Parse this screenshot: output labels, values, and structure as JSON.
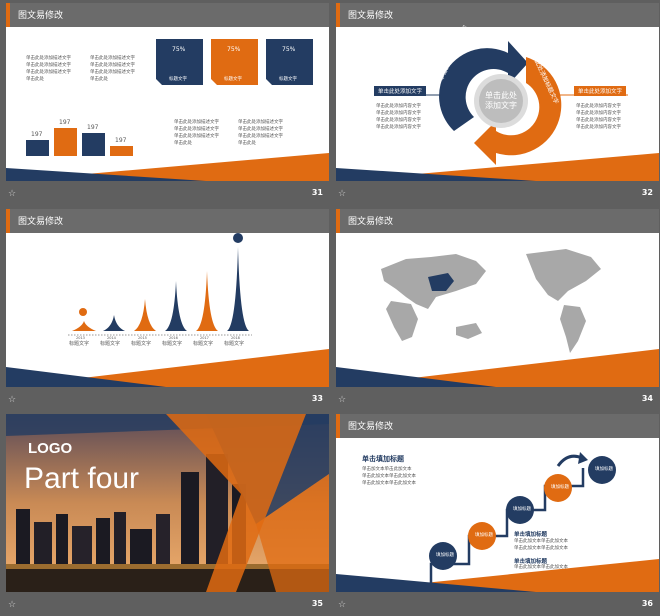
{
  "colors": {
    "navy": "#233c62",
    "orange": "#e06b12",
    "gray": "#6b6b6b"
  },
  "slides": [
    {
      "num": "31",
      "title": "图文易修改",
      "text_lines": [
        "单击此处添加描述文字",
        "单击此处添加描述文字",
        "单击此处添加描述文字",
        "单击此处"
      ],
      "bar_values": [
        "197",
        "197",
        "197",
        "197"
      ],
      "percents": [
        "75%",
        "75%",
        "75%"
      ],
      "box_labels": [
        "标题文字",
        "标题文字",
        "标题文字"
      ],
      "lines_b": [
        "单击此处添加描述文字",
        "单击此处添加描述文字",
        "单击此处添加描述文字",
        "单击此处"
      ]
    },
    {
      "num": "32",
      "title": "图文易修改",
      "center": "单击此处添加文字",
      "left_title": "单击此处添加文字",
      "right_title": "单击此处添加文字",
      "arc_left": "单击此处添加标题文字",
      "arc_right": "单击此处添加标题文字",
      "items": [
        "单击此处添加内容文字",
        "单击此处添加内容文字",
        "单击此处添加内容文字",
        "单击此处添加内容文字"
      ]
    },
    {
      "num": "33",
      "title": "图文易修改",
      "labels": [
        "标题文字",
        "标题文字",
        "标题文字",
        "标题文字",
        "标题文字",
        "标题文字"
      ],
      "years": [
        "2013",
        "2014",
        "2015",
        "2016",
        "2017",
        "2018"
      ]
    },
    {
      "num": "34",
      "title": "图文易修改"
    },
    {
      "num": "35",
      "logo": "LOGO",
      "part": "Part four"
    },
    {
      "num": "36",
      "title": "图文易修改",
      "main_title": "单击填加标题",
      "main_lines": [
        "单击加文本单击此加文本",
        "单击此加文本单击此加文本",
        "单击此加文本单击此加文本"
      ],
      "sub_title": "单击填加标题",
      "sub_lines": [
        "单击此加文本单击此加文本",
        "单击此加文本单击此加文本"
      ],
      "sub2_title": "单击填加标题",
      "sub2_lines": [
        "单击此加文本单击此加文本",
        "单击此加文本单击此加文本"
      ],
      "circle_text": "填加标题"
    }
  ]
}
